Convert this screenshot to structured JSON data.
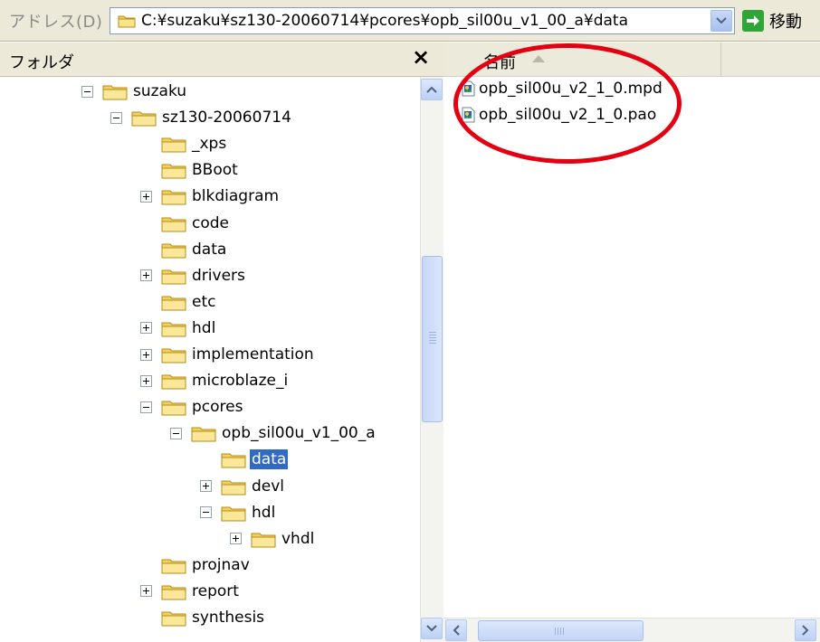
{
  "address": {
    "label": "アドレス(D)",
    "path": "C:¥suzaku¥sz130-20060714¥pcores¥opb_sil00u_v1_00_a¥data",
    "go_label": "移動",
    "folder_icon": "folder-icon",
    "dropdown_icon": "chevron-down-icon",
    "go_icon": "green-arrow-icon"
  },
  "folder_pane": {
    "title": "フォルダ",
    "close_symbol": "×"
  },
  "tree": [
    {
      "label": "suzaku",
      "toggle": "minus"
    },
    {
      "label": "sz130-20060714",
      "toggle": "minus"
    },
    {
      "label": "_xps",
      "toggle": "none"
    },
    {
      "label": "BBoot",
      "toggle": "none"
    },
    {
      "label": "blkdiagram",
      "toggle": "plus"
    },
    {
      "label": "code",
      "toggle": "none"
    },
    {
      "label": "data",
      "toggle": "none"
    },
    {
      "label": "drivers",
      "toggle": "plus"
    },
    {
      "label": "etc",
      "toggle": "none"
    },
    {
      "label": "hdl",
      "toggle": "plus"
    },
    {
      "label": "implementation",
      "toggle": "plus"
    },
    {
      "label": "microblaze_i",
      "toggle": "plus"
    },
    {
      "label": "pcores",
      "toggle": "minus"
    },
    {
      "label": "opb_sil00u_v1_00_a",
      "toggle": "minus"
    },
    {
      "label": "data",
      "toggle": "none",
      "selected": true
    },
    {
      "label": "devl",
      "toggle": "plus"
    },
    {
      "label": "hdl",
      "toggle": "minus"
    },
    {
      "label": "vhdl",
      "toggle": "plus"
    },
    {
      "label": "projnav",
      "toggle": "none"
    },
    {
      "label": "report",
      "toggle": "plus"
    },
    {
      "label": "synthesis",
      "toggle": "none"
    }
  ],
  "list": {
    "column_name": "名前",
    "files": [
      {
        "label": "opb_sil00u_v2_1_0.mpd",
        "icon": "file-icon"
      },
      {
        "label": "opb_sil00u_v2_1_0.pao",
        "icon": "file-icon"
      }
    ]
  },
  "colors": {
    "selection": "#316ac5",
    "annotation": "#e40010",
    "folder": "#f5d76e"
  }
}
